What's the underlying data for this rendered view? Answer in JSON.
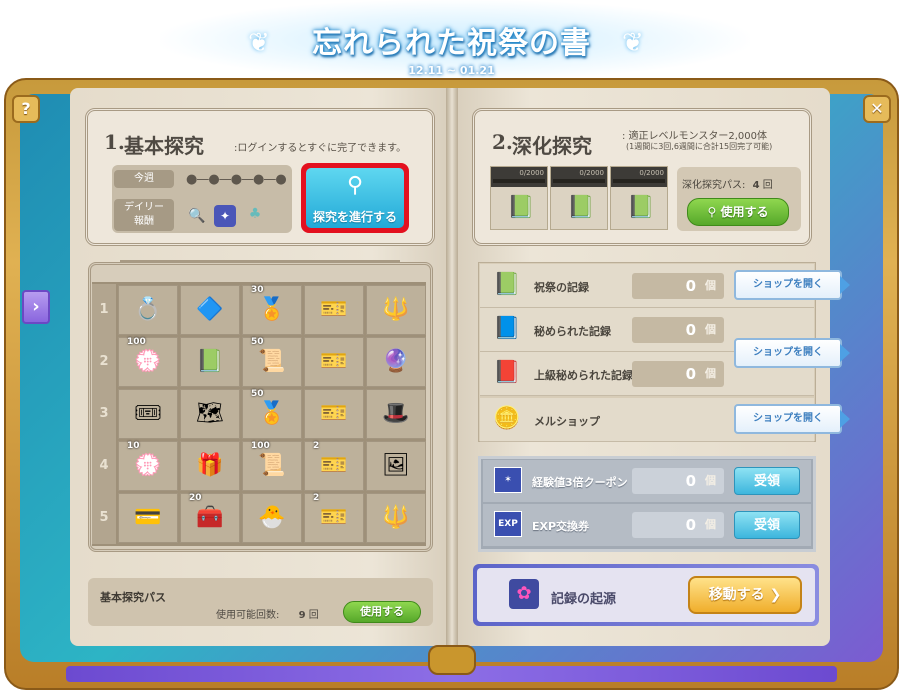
{
  "header": {
    "title": "忘れられた祝祭の書",
    "date_range": "12.11 ~ 01.21"
  },
  "frame": {
    "help_icon": "?",
    "close_icon": "✕",
    "left_nav_icon": "›"
  },
  "section1": {
    "number": "1.",
    "title": "基本探究",
    "subtitle": ":ログインするとすぐに完了できます。",
    "week_label": "今週",
    "week_progress_dots": 5,
    "week_progress_done": 0,
    "daily_label_line1": "デイリー",
    "daily_label_line2": "報酬",
    "search_button": "探究を進行する"
  },
  "grid": {
    "rows": [
      {
        "num": "1",
        "items": [
          {
            "icon": "ring",
            "badge": ""
          },
          {
            "icon": "crystal",
            "badge": ""
          },
          {
            "icon": "medal",
            "badge": "30"
          },
          {
            "icon": "ticket",
            "badge": ""
          },
          {
            "icon": "staff",
            "badge": ""
          }
        ]
      },
      {
        "num": "2",
        "items": [
          {
            "icon": "flowers",
            "badge": "100"
          },
          {
            "icon": "book",
            "badge": ""
          },
          {
            "icon": "scroll",
            "badge": "50"
          },
          {
            "icon": "ticket",
            "badge": ""
          },
          {
            "icon": "orb",
            "badge": ""
          }
        ]
      },
      {
        "num": "3",
        "items": [
          {
            "icon": "coupon",
            "badge": ""
          },
          {
            "icon": "map",
            "badge": ""
          },
          {
            "icon": "medal",
            "badge": "50"
          },
          {
            "icon": "ticket",
            "badge": ""
          },
          {
            "icon": "hat",
            "badge": ""
          }
        ]
      },
      {
        "num": "4",
        "items": [
          {
            "icon": "flowers",
            "badge": "10"
          },
          {
            "icon": "giftbox",
            "badge": ""
          },
          {
            "icon": "scroll",
            "badge": "100"
          },
          {
            "icon": "ticket",
            "badge": "2"
          },
          {
            "icon": "portrait",
            "badge": ""
          }
        ]
      },
      {
        "num": "5",
        "items": [
          {
            "icon": "card",
            "badge": ""
          },
          {
            "icon": "chest",
            "badge": "20"
          },
          {
            "icon": "pet",
            "badge": ""
          },
          {
            "icon": "ticket",
            "badge": "2"
          },
          {
            "icon": "staff",
            "badge": ""
          }
        ]
      }
    ]
  },
  "basic_pass": {
    "title": "基本探究パス",
    "count_label": "使用可能回数:",
    "count": "9",
    "count_unit": "回",
    "use_button": "使用する"
  },
  "section2": {
    "number": "2.",
    "title": "深化探究",
    "subtitle_line1": ": 適正レベルモンスター2,000体",
    "subtitle_line2": "(1週間に3回,6週間に合計15回完了可能)",
    "progress": [
      {
        "label": "0/2000",
        "value": 0,
        "max": 2000
      },
      {
        "label": "0/2000",
        "value": 0,
        "max": 2000
      },
      {
        "label": "0/2000",
        "value": 0,
        "max": 2000
      }
    ],
    "pass_label": "深化探究パス:",
    "pass_count": "4",
    "pass_unit": "回",
    "use_button": "使用する"
  },
  "records": [
    {
      "label": "祝祭の記録",
      "count": "0",
      "unit": "個",
      "icon": "green-book-icon"
    },
    {
      "label": "秘められた記録",
      "count": "0",
      "unit": "個",
      "icon": "dark-book-icon"
    },
    {
      "label": "上級秘められた記録",
      "count": "0",
      "unit": "個",
      "icon": "red-book-icon"
    },
    {
      "label": "メルショップ",
      "icon": "meso-coin-icon"
    }
  ],
  "shop_buttons": [
    "ショップを開く",
    "ショップを開く",
    "ショップを開く"
  ],
  "exp_items": [
    {
      "label": "経験値3倍クーポン",
      "count": "0",
      "unit": "個",
      "button": "受領",
      "icon": "exp-coupon-icon"
    },
    {
      "label": "EXP交換券",
      "count": "0",
      "unit": "個",
      "button": "受領",
      "icon": "exp-ticket-icon",
      "icon_text": "EXP"
    }
  ],
  "origin": {
    "label": "記録の起源",
    "move_button": "移動する"
  },
  "colors": {
    "highlight_border": "#e3111f",
    "search_button": "#22a9d7",
    "green_button": "#56a82a",
    "move_button": "#f0ae2c"
  }
}
